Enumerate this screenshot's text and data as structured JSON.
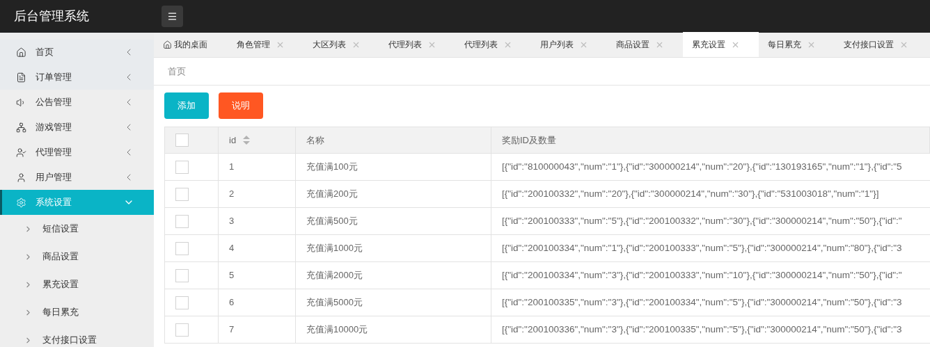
{
  "app_title": "后台管理系统",
  "sidebar": {
    "items": [
      {
        "label": "首页",
        "expanded": false,
        "selected": false
      },
      {
        "label": "订单管理",
        "expanded": false,
        "selected": false
      },
      {
        "label": "公告管理",
        "expanded": false,
        "selected": false
      },
      {
        "label": "游戏管理",
        "expanded": false,
        "selected": false
      },
      {
        "label": "代理管理",
        "expanded": false,
        "selected": false
      },
      {
        "label": "用户管理",
        "expanded": false,
        "selected": false
      },
      {
        "label": "系统设置",
        "expanded": true,
        "selected": true,
        "children": [
          {
            "label": "短信设置",
            "selected": false
          },
          {
            "label": "商品设置",
            "selected": false
          },
          {
            "label": "累充设置",
            "selected": false
          },
          {
            "label": "每日累充",
            "selected": false
          },
          {
            "label": "支付接口设置",
            "selected": false
          }
        ]
      }
    ]
  },
  "tabs": [
    {
      "label": "我的桌面",
      "kind": "home",
      "selected": false
    },
    {
      "label": "角色管理",
      "kind": "closable",
      "selected": false
    },
    {
      "label": "大区列表",
      "kind": "closable",
      "selected": false
    },
    {
      "label": "代理列表",
      "kind": "closable",
      "selected": false
    },
    {
      "label": "代理列表",
      "kind": "closable",
      "selected": false
    },
    {
      "label": "用户列表",
      "kind": "closable",
      "selected": false
    },
    {
      "label": "商品设置",
      "kind": "closable",
      "selected": false
    },
    {
      "label": "累充设置",
      "kind": "closable",
      "selected": true
    },
    {
      "label": "每日累充",
      "kind": "closable",
      "selected": false
    },
    {
      "label": "支付接口设置",
      "kind": "closable",
      "selected": false
    }
  ],
  "breadcrumb": "首页",
  "buttons": [
    {
      "label": "添加",
      "kind": "primary"
    },
    {
      "label": "说明",
      "kind": "warning"
    }
  ],
  "table": {
    "header_checked": false,
    "columns": [
      {
        "label": "id",
        "sortable": true
      },
      {
        "label": "名称",
        "sortable": false
      },
      {
        "label": "奖励ID及数量",
        "sortable": false
      }
    ],
    "rows": [
      {
        "checked": false,
        "id": "1",
        "name": "充值满100元",
        "rewards": "[{\"id\":\"810000043\",\"num\":\"1\"},{\"id\":\"300000214\",\"num\":\"20\"},{\"id\":\"130193165\",\"num\":\"1\"},{\"id\":\"5"
      },
      {
        "checked": false,
        "id": "2",
        "name": "充值满200元",
        "rewards": "[{\"id\":\"200100332\",\"num\":\"20\"},{\"id\":\"300000214\",\"num\":\"30\"},{\"id\":\"531003018\",\"num\":\"1\"}]"
      },
      {
        "checked": false,
        "id": "3",
        "name": "充值满500元",
        "rewards": "[{\"id\":\"200100333\",\"num\":\"5\"},{\"id\":\"200100332\",\"num\":\"30\"},{\"id\":\"300000214\",\"num\":\"50\"},{\"id\":\""
      },
      {
        "checked": false,
        "id": "4",
        "name": "充值满1000元",
        "rewards": "[{\"id\":\"200100334\",\"num\":\"1\"},{\"id\":\"200100333\",\"num\":\"5\"},{\"id\":\"300000214\",\"num\":\"80\"},{\"id\":\"3"
      },
      {
        "checked": false,
        "id": "5",
        "name": "充值满2000元",
        "rewards": "[{\"id\":\"200100334\",\"num\":\"3\"},{\"id\":\"200100333\",\"num\":\"10\"},{\"id\":\"300000214\",\"num\":\"50\"},{\"id\":\""
      },
      {
        "checked": false,
        "id": "6",
        "name": "充值满5000元",
        "rewards": "[{\"id\":\"200100335\",\"num\":\"3\"},{\"id\":\"200100334\",\"num\":\"5\"},{\"id\":\"300000214\",\"num\":\"50\"},{\"id\":\"3"
      },
      {
        "checked": false,
        "id": "7",
        "name": "充值满10000元",
        "rewards": "[{\"id\":\"200100336\",\"num\":\"3\"},{\"id\":\"200100335\",\"num\":\"5\"},{\"id\":\"300000214\",\"num\":\"50\"},{\"id\":\"3"
      }
    ]
  }
}
